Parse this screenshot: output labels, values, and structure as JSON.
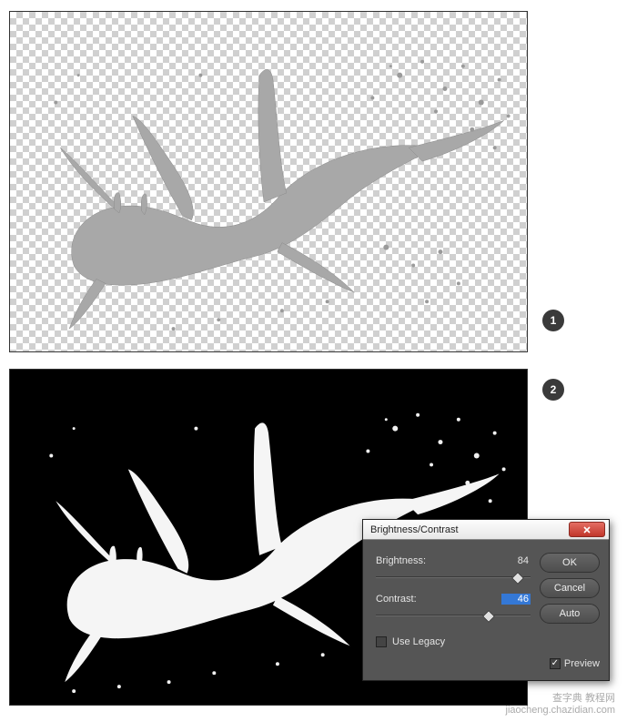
{
  "badges": {
    "one": "1",
    "two": "2"
  },
  "dialog": {
    "title": "Brightness/Contrast",
    "close_icon": "close-icon",
    "brightness_label": "Brightness:",
    "brightness_value": "84",
    "contrast_label": "Contrast:",
    "contrast_value": "46",
    "legacy_label": "Use Legacy",
    "ok_label": "OK",
    "cancel_label": "Cancel",
    "auto_label": "Auto",
    "preview_label": "Preview",
    "brightness_handle_percent": 92,
    "contrast_handle_percent": 73
  },
  "watermark": {
    "line1": "查字典 教程网",
    "line2": "jiaocheng.chazidian.com"
  }
}
